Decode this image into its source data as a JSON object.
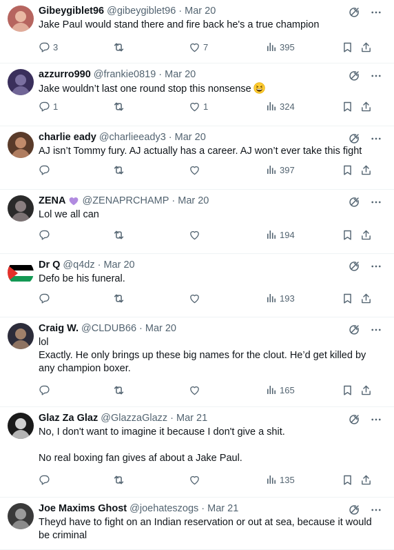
{
  "tweets": [
    {
      "name": "Gibeygiblet96",
      "handle": "@gibeygiblet96",
      "sep": "·",
      "time": "Mar 20",
      "lines": [
        "Jake Paul would stand there and fire back he's a true champion"
      ],
      "replies": "3",
      "retweets": "",
      "likes": "7",
      "views": "395",
      "avatar_colors": [
        "#b6655f",
        "#e9b9a4"
      ]
    },
    {
      "name": "azzurro990",
      "handle": "@frankie0819",
      "sep": "·",
      "time": "Mar 20",
      "lines": [
        "Jake wouldn’t last one round stop this nonsense"
      ],
      "emoji": "grinning-squinting-face",
      "replies": "1",
      "retweets": "",
      "likes": "1",
      "views": "324",
      "avatar_colors": [
        "#3a2f5c",
        "#7a6fa0"
      ]
    },
    {
      "name": "charlie eady",
      "handle": "@charlieeady3",
      "sep": "·",
      "time": "Mar 20",
      "lines": [
        "AJ isn’t Tommy fury. AJ actually has a career. AJ won’t ever take this fight"
      ],
      "replies": "",
      "retweets": "",
      "likes": "",
      "views": "397",
      "avatar_colors": [
        "#5a3b2a",
        "#c08a6a"
      ]
    },
    {
      "name": "ZENA",
      "badge": "purple-heart",
      "handle": "@ZENAPRCHAMP",
      "sep": "·",
      "time": "Mar 20",
      "lines": [
        "Lol we all can"
      ],
      "replies": "",
      "retweets": "",
      "likes": "",
      "views": "194",
      "avatar_colors": [
        "#2a2a2a",
        "#8a7f80"
      ]
    },
    {
      "name": "Dr Q",
      "handle": "@q4dz",
      "sep": "·",
      "time": "Mar 20",
      "lines": [
        "Defo be his funeral."
      ],
      "replies": "",
      "retweets": "",
      "likes": "",
      "views": "193",
      "avatar_colors": [
        "#000000",
        "#149954",
        "#e4312b"
      ]
    },
    {
      "name": "Craig W.",
      "handle": "@CLDUB66",
      "sep": "·",
      "time": "Mar 20",
      "lines": [
        "lol",
        "Exactly. He only brings up these big names for the clout. He’d get killed by",
        "any champion boxer."
      ],
      "replies": "",
      "retweets": "",
      "likes": "",
      "views": "165",
      "avatar_colors": [
        "#2c2c3a",
        "#a0806a"
      ]
    },
    {
      "name": "Glaz Za Glaz",
      "handle": "@GlazzaGlazz",
      "sep": "·",
      "time": "Mar 21",
      "lines": [
        "No, I don't want to imagine it because I don't give a shit.",
        "",
        "No real boxing fan gives af about a Jake Paul."
      ],
      "replies": "",
      "retweets": "",
      "likes": "",
      "views": "135",
      "avatar_colors": [
        "#1a1a1a",
        "#d0d0d0"
      ]
    },
    {
      "name": "Joe Maxims Ghost",
      "handle": "@joehateszogs",
      "sep": "·",
      "time": "Mar 21",
      "lines": [
        "Theyd have to fight on an Indian reservation or out at sea, because it would",
        "be criminal"
      ],
      "replies": "",
      "retweets": "",
      "likes": "",
      "views": "",
      "avatar_colors": [
        "#3a3a3a",
        "#9a9a9a"
      ]
    }
  ],
  "icons": {
    "grok": "grok-icon",
    "more": "more-icon",
    "reply": "reply-icon",
    "retweet": "retweet-icon",
    "like": "heart-icon",
    "views": "views-icon",
    "bookmark": "bookmark-icon",
    "share": "share-icon"
  },
  "colors": {
    "text": "#0f1419",
    "muted": "#536471",
    "divider": "#eff3f4",
    "badge": "#b18be0"
  }
}
